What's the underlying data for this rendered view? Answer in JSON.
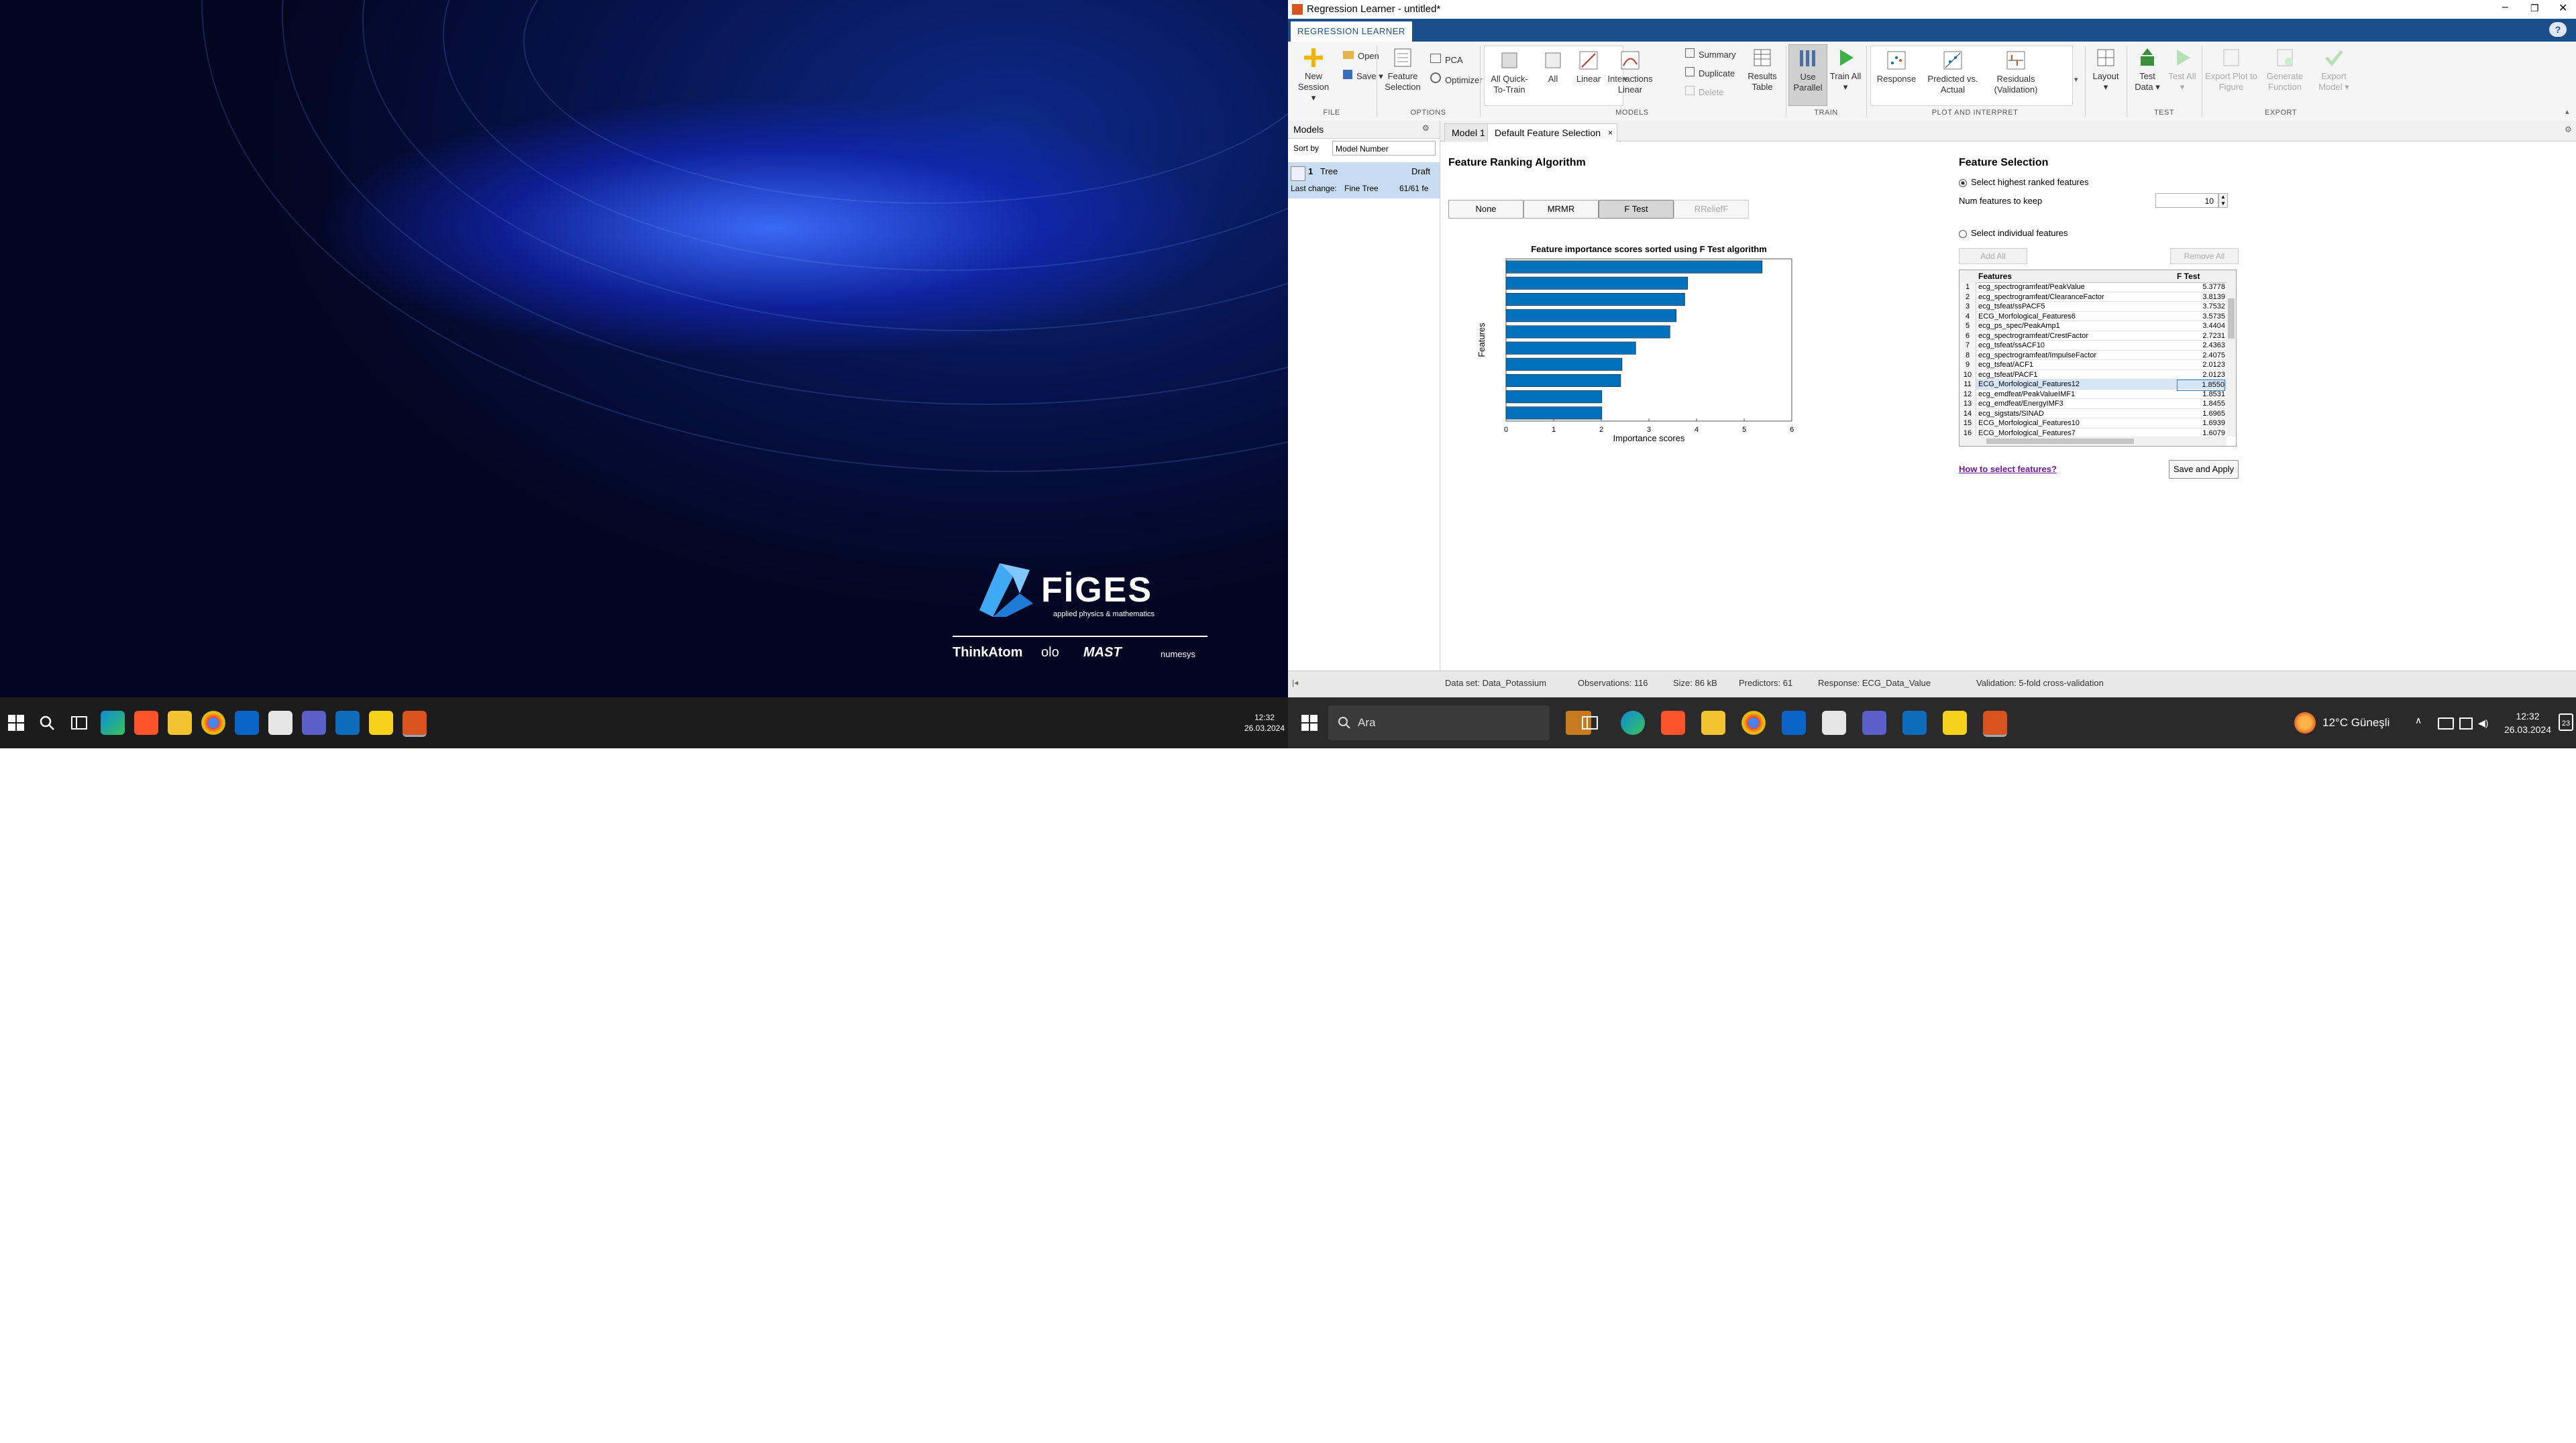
{
  "left_taskbar": {
    "time": "12:32",
    "date": "26.03.2024"
  },
  "right_taskbar": {
    "search_label": "Ara",
    "weather": "12°C Güneşli",
    "time": "12:32",
    "date": "26.03.2024",
    "notification_count": "23"
  },
  "wallpaper": {
    "brand": "FİGES",
    "tagline": "applied physics & mathematics",
    "partners": [
      "ThinkAtom",
      "olo",
      "MAST",
      "numesys"
    ]
  },
  "window": {
    "title": "Regression Learner - untitled*",
    "app_tab": "REGRESSION LEARNER",
    "help": "?"
  },
  "ribbon": {
    "file": {
      "section": "FILE",
      "new_session": "New Session",
      "open": "Open",
      "save": "Save"
    },
    "options": {
      "section": "OPTIONS",
      "feature_selection": "Feature Selection",
      "pca": "PCA",
      "optimizer": "Optimizer"
    },
    "models": {
      "section": "MODELS",
      "all_quick": "All Quick-To-Train",
      "all": "All",
      "linear": "Linear",
      "interactions_linear": "Interactions Linear",
      "summary": "Summary",
      "duplicate": "Duplicate",
      "delete": "Delete",
      "results_table": "Results Table"
    },
    "train": {
      "section": "TRAIN",
      "use_parallel": "Use Parallel",
      "train_all": "Train All"
    },
    "plot": {
      "section": "PLOT AND INTERPRET",
      "response": "Response",
      "predicted_vs_actual": "Predicted vs. Actual",
      "residuals": "Residuals (Validation)"
    },
    "layout": "Layout",
    "test": {
      "section": "TEST",
      "test_data": "Test Data",
      "test_all": "Test All"
    },
    "export": {
      "section": "EXPORT",
      "export_plot": "Export Plot to Figure",
      "generate_function": "Generate Function",
      "export_model": "Export Model"
    }
  },
  "models_panel": {
    "title": "Models",
    "sort_label": "Sort by",
    "sort_value": "Model Number",
    "model": {
      "number": "1",
      "type": "Tree",
      "status": "Draft",
      "last_change_label": "Last change:",
      "last_change_value": "Fine Tree",
      "features": "61/61 fe"
    }
  },
  "doc_tabs": [
    "Model 1",
    "Default Feature Selection"
  ],
  "feature_ranking": {
    "title": "Feature Ranking Algorithm",
    "buttons": [
      "None",
      "MRMR",
      "F Test",
      "RReliefF"
    ],
    "selected": "F Test"
  },
  "chart_data": {
    "type": "bar",
    "orientation": "horizontal",
    "title": "Feature importance scores sorted using F Test algorithm",
    "xlabel": "Importance scores",
    "ylabel": "Features",
    "xlim": [
      0,
      6
    ],
    "xticks": [
      "0",
      "1",
      "2",
      "3",
      "4",
      "5",
      "6"
    ],
    "values": [
      5.3778,
      3.8139,
      3.7532,
      3.5735,
      3.4404,
      2.7231,
      2.4363,
      2.4075,
      2.0123,
      2.0123
    ],
    "bar_color": "#0072BD"
  },
  "feature_selection": {
    "title": "Feature Selection",
    "opt_highest": "Select highest ranked features",
    "num_label": "Num features to keep",
    "num_value": "10",
    "opt_individual": "Select individual features",
    "add_all": "Add All",
    "remove_all": "Remove All",
    "columns": [
      "Features",
      "F Test"
    ],
    "rows": [
      {
        "n": "1",
        "name": "ecg_spectrogramfeat/PeakValue",
        "score": "5.3778"
      },
      {
        "n": "2",
        "name": "ecg_spectrogramfeat/ClearanceFactor",
        "score": "3.8139"
      },
      {
        "n": "3",
        "name": "ecg_tsfeat/ssPACF5",
        "score": "3.7532"
      },
      {
        "n": "4",
        "name": "ECG_Morfological_Features6",
        "score": "3.5735"
      },
      {
        "n": "5",
        "name": "ecg_ps_spec/PeakAmp1",
        "score": "3.4404"
      },
      {
        "n": "6",
        "name": "ecg_spectrogramfeat/CrestFactor",
        "score": "2.7231"
      },
      {
        "n": "7",
        "name": "ecg_tsfeat/ssACF10",
        "score": "2.4363"
      },
      {
        "n": "8",
        "name": "ecg_spectrogramfeat/ImpulseFactor",
        "score": "2.4075"
      },
      {
        "n": "9",
        "name": "ecg_tsfeat/ACF1",
        "score": "2.0123"
      },
      {
        "n": "10",
        "name": "ecg_tsfeat/PACF1",
        "score": "2.0123"
      },
      {
        "n": "11",
        "name": "ECG_Morfological_Features12",
        "score": "1.8550"
      },
      {
        "n": "12",
        "name": "ecg_emdfeat/PeakValueIMF1",
        "score": "1.8531"
      },
      {
        "n": "13",
        "name": "ecg_emdfeat/EnergyIMF3",
        "score": "1.8455"
      },
      {
        "n": "14",
        "name": "ecg_sigstats/SINAD",
        "score": "1.6965"
      },
      {
        "n": "15",
        "name": "ECG_Morfological_Features10",
        "score": "1.6939"
      },
      {
        "n": "16",
        "name": "ECG_Morfological_Features7",
        "score": "1.6079"
      }
    ],
    "help_link": "How to select features?",
    "save_apply": "Save and Apply"
  },
  "status": {
    "dataset": "Data set: Data_Potassium",
    "observations": "Observations: 116",
    "size": "Size: 86 kB",
    "predictors": "Predictors: 61",
    "response": "Response: ECG_Data_Value",
    "validation": "Validation: 5-fold cross-validation"
  }
}
